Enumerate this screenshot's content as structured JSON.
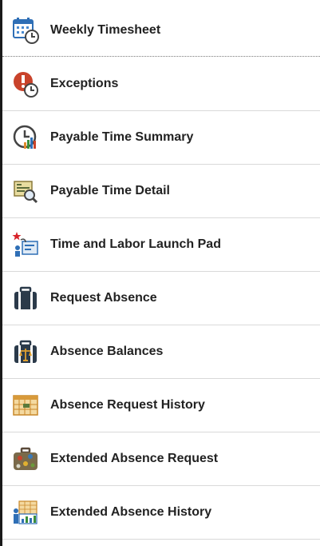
{
  "menu": {
    "items": [
      {
        "label": "Weekly Timesheet",
        "icon": "calendar-clock-icon"
      },
      {
        "label": "Exceptions",
        "icon": "exception-clock-icon"
      },
      {
        "label": "Payable Time Summary",
        "icon": "time-chart-icon"
      },
      {
        "label": "Payable Time Detail",
        "icon": "detail-magnifier-icon"
      },
      {
        "label": "Time and Labor Launch Pad",
        "icon": "launch-pad-icon"
      },
      {
        "label": "Request Absence",
        "icon": "briefcase-icon"
      },
      {
        "label": "Absence Balances",
        "icon": "briefcase-scale-icon"
      },
      {
        "label": "Absence Request History",
        "icon": "calendar-history-icon"
      },
      {
        "label": "Extended Absence Request",
        "icon": "suitcase-icon"
      },
      {
        "label": "Extended Absence History",
        "icon": "person-calendar-chart-icon"
      }
    ]
  }
}
